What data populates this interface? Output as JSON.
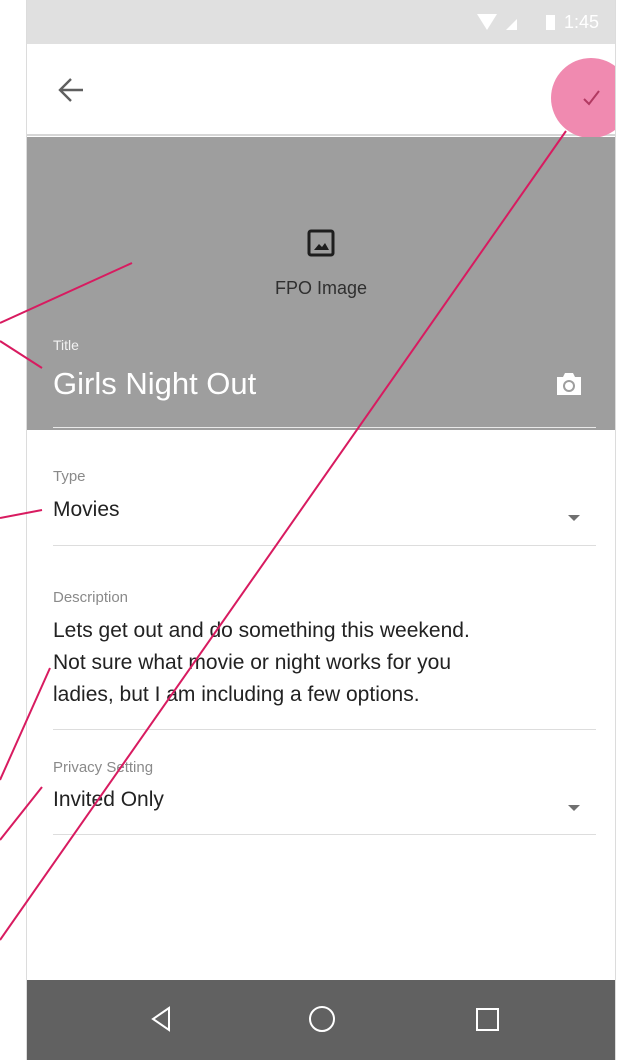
{
  "status_bar": {
    "time": "1:45"
  },
  "toolbar": {
    "back_icon": "arrow-back-icon",
    "confirm_icon": "check-icon"
  },
  "hero": {
    "image_placeholder": "FPO Image",
    "title_label": "Title",
    "title_value": "Girls Night Out",
    "camera_icon": "camera-icon"
  },
  "fields": {
    "type": {
      "label": "Type",
      "value": "Movies"
    },
    "description": {
      "label": "Description",
      "lines": [
        "Lets get out and do something this weekend.",
        "Not sure what movie or night works for you",
        "ladies, but I am including a few options."
      ]
    },
    "privacy": {
      "label": "Privacy Setting",
      "value": "Invited Only"
    }
  },
  "nav_bar": {
    "icons": [
      "back-triangle-icon",
      "home-circle-icon",
      "recents-square-icon"
    ]
  },
  "colors": {
    "accent": "#f08ab0",
    "annotation_line": "#d81b60",
    "hero_bg": "#9e9e9e",
    "nav_bg": "#616161",
    "status_bg": "#e0e0e0"
  }
}
